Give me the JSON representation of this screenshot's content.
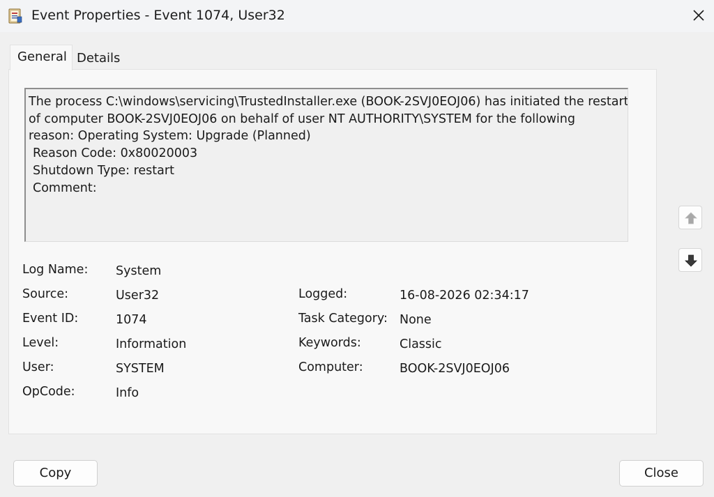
{
  "window": {
    "title": "Event Properties - Event 1074, User32",
    "app_icon": "event-viewer-icon",
    "close_icon": "close-icon"
  },
  "tabs": [
    {
      "label": "General",
      "selected": true
    },
    {
      "label": "Details",
      "selected": false
    }
  ],
  "description": {
    "lines": [
      "The process C:\\windows\\servicing\\TrustedInstaller.exe (BOOK-2SVJ0EOJ06) has initiated the restart",
      "of computer BOOK-2SVJ0EOJ06 on behalf of user NT AUTHORITY\\SYSTEM for the following",
      "reason: Operating System: Upgrade (Planned)",
      " Reason Code: 0x80020003",
      " Shutdown Type: restart",
      " Comment:"
    ]
  },
  "fields": {
    "log_name": {
      "label": "Log Name:",
      "value": "System"
    },
    "source": {
      "label": "Source:",
      "value": "User32"
    },
    "logged": {
      "label": "Logged:",
      "value": "16-08-2026 02:34:17"
    },
    "event_id": {
      "label": "Event ID:",
      "value": "1074"
    },
    "task_category": {
      "label": "Task Category:",
      "value": "None"
    },
    "level": {
      "label": "Level:",
      "value": "Information"
    },
    "keywords": {
      "label": "Keywords:",
      "value": "Classic"
    },
    "user": {
      "label": "User:",
      "value": "SYSTEM"
    },
    "computer": {
      "label": "Computer:",
      "value": "BOOK-2SVJ0EOJ06"
    },
    "opcode": {
      "label": "OpCode:",
      "value": "Info"
    }
  },
  "nav": {
    "up_icon": "arrow-up-icon",
    "down_icon": "arrow-down-icon",
    "up_enabled": false,
    "down_enabled": true
  },
  "buttons": {
    "copy": "Copy",
    "close": "Close"
  }
}
